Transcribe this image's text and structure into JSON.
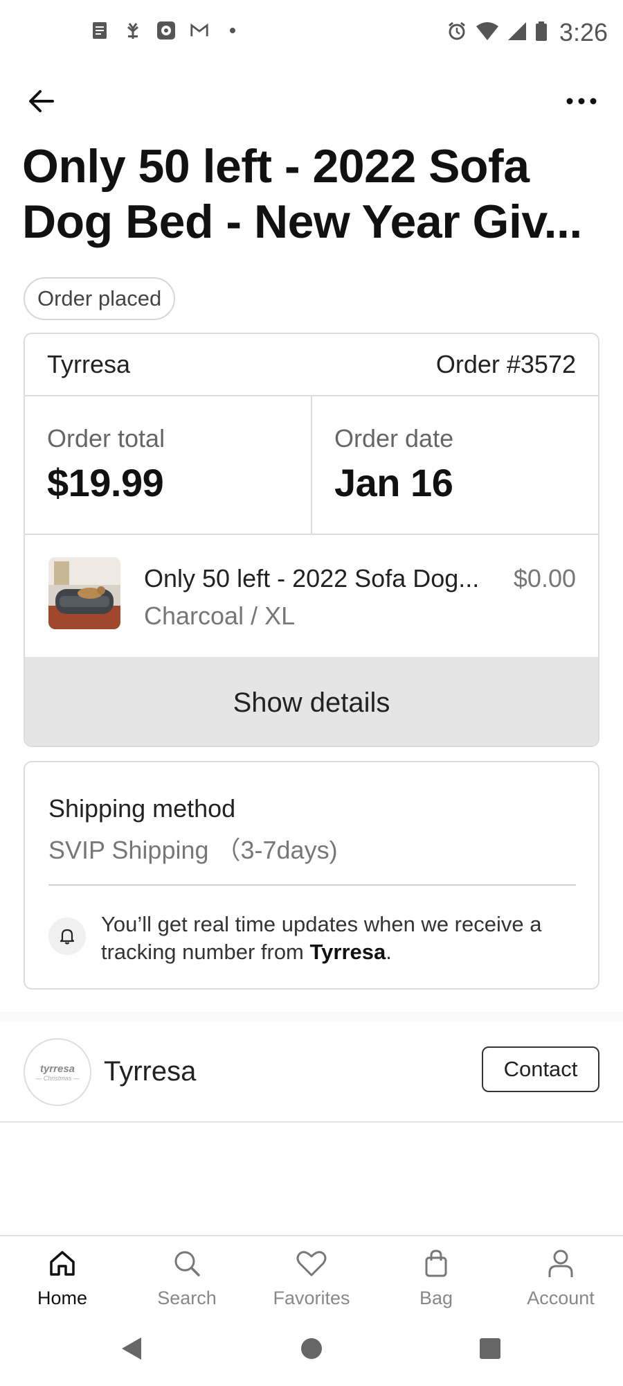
{
  "status_bar": {
    "time": "3:26",
    "left_icons": [
      "document-icon",
      "plant-icon",
      "photo-icon",
      "gmail-icon",
      "dot-icon"
    ],
    "right_icons": [
      "alarm-icon",
      "wifi-icon",
      "signal-icon",
      "battery-icon"
    ]
  },
  "header": {
    "title": "Only 50 left - 2022 Sofa Dog Bed - New Year Giv..."
  },
  "order_status": "Order placed",
  "order": {
    "store": "Tyrresa",
    "number": "Order #3572",
    "total_label": "Order total",
    "total_value": "$19.99",
    "date_label": "Order date",
    "date_value": "Jan 16",
    "item": {
      "name": "Only 50 left - 2022 Sofa Dog...",
      "price": "$0.00",
      "variant": "Charcoal / XL"
    },
    "show_details_label": "Show details"
  },
  "shipping": {
    "label": "Shipping method",
    "method": "SVIP Shipping （3-7days)",
    "note_prefix": "You’ll get real time updates when we receive a tracking number from ",
    "note_store": "Tyrresa",
    "note_suffix": "."
  },
  "seller": {
    "logo_text": "tyrresa",
    "logo_subtext": "— Christmas —",
    "name": "Tyrresa",
    "contact_label": "Contact"
  },
  "bottom_nav": [
    {
      "label": "Home",
      "icon": "home-icon",
      "active": true
    },
    {
      "label": "Search",
      "icon": "search-icon",
      "active": false
    },
    {
      "label": "Favorites",
      "icon": "heart-icon",
      "active": false
    },
    {
      "label": "Bag",
      "icon": "bag-icon",
      "active": false
    },
    {
      "label": "Account",
      "icon": "person-icon",
      "active": false
    }
  ],
  "colors": {
    "text_primary": "#111111",
    "text_secondary": "#777777",
    "border": "#dcdcdc",
    "details_bg": "#e5e5e5"
  }
}
